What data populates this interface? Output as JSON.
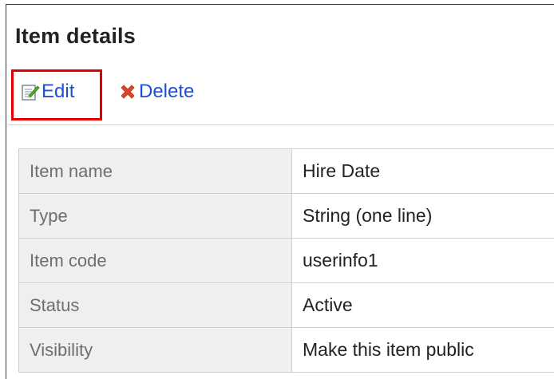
{
  "page": {
    "title": "Item details"
  },
  "toolbar": {
    "edit_label": "Edit",
    "delete_label": "Delete",
    "edit_icon": "edit-pencil-icon",
    "delete_icon": "delete-x-icon",
    "highlight_color": "#e00000",
    "link_color": "#1a4fd6"
  },
  "details": {
    "rows": [
      {
        "label": "Item name",
        "value": "Hire Date"
      },
      {
        "label": "Type",
        "value": "String (one line)"
      },
      {
        "label": "Item code",
        "value": "userinfo1"
      },
      {
        "label": "Status",
        "value": "Active"
      },
      {
        "label": "Visibility",
        "value": "Make this item public"
      }
    ]
  }
}
